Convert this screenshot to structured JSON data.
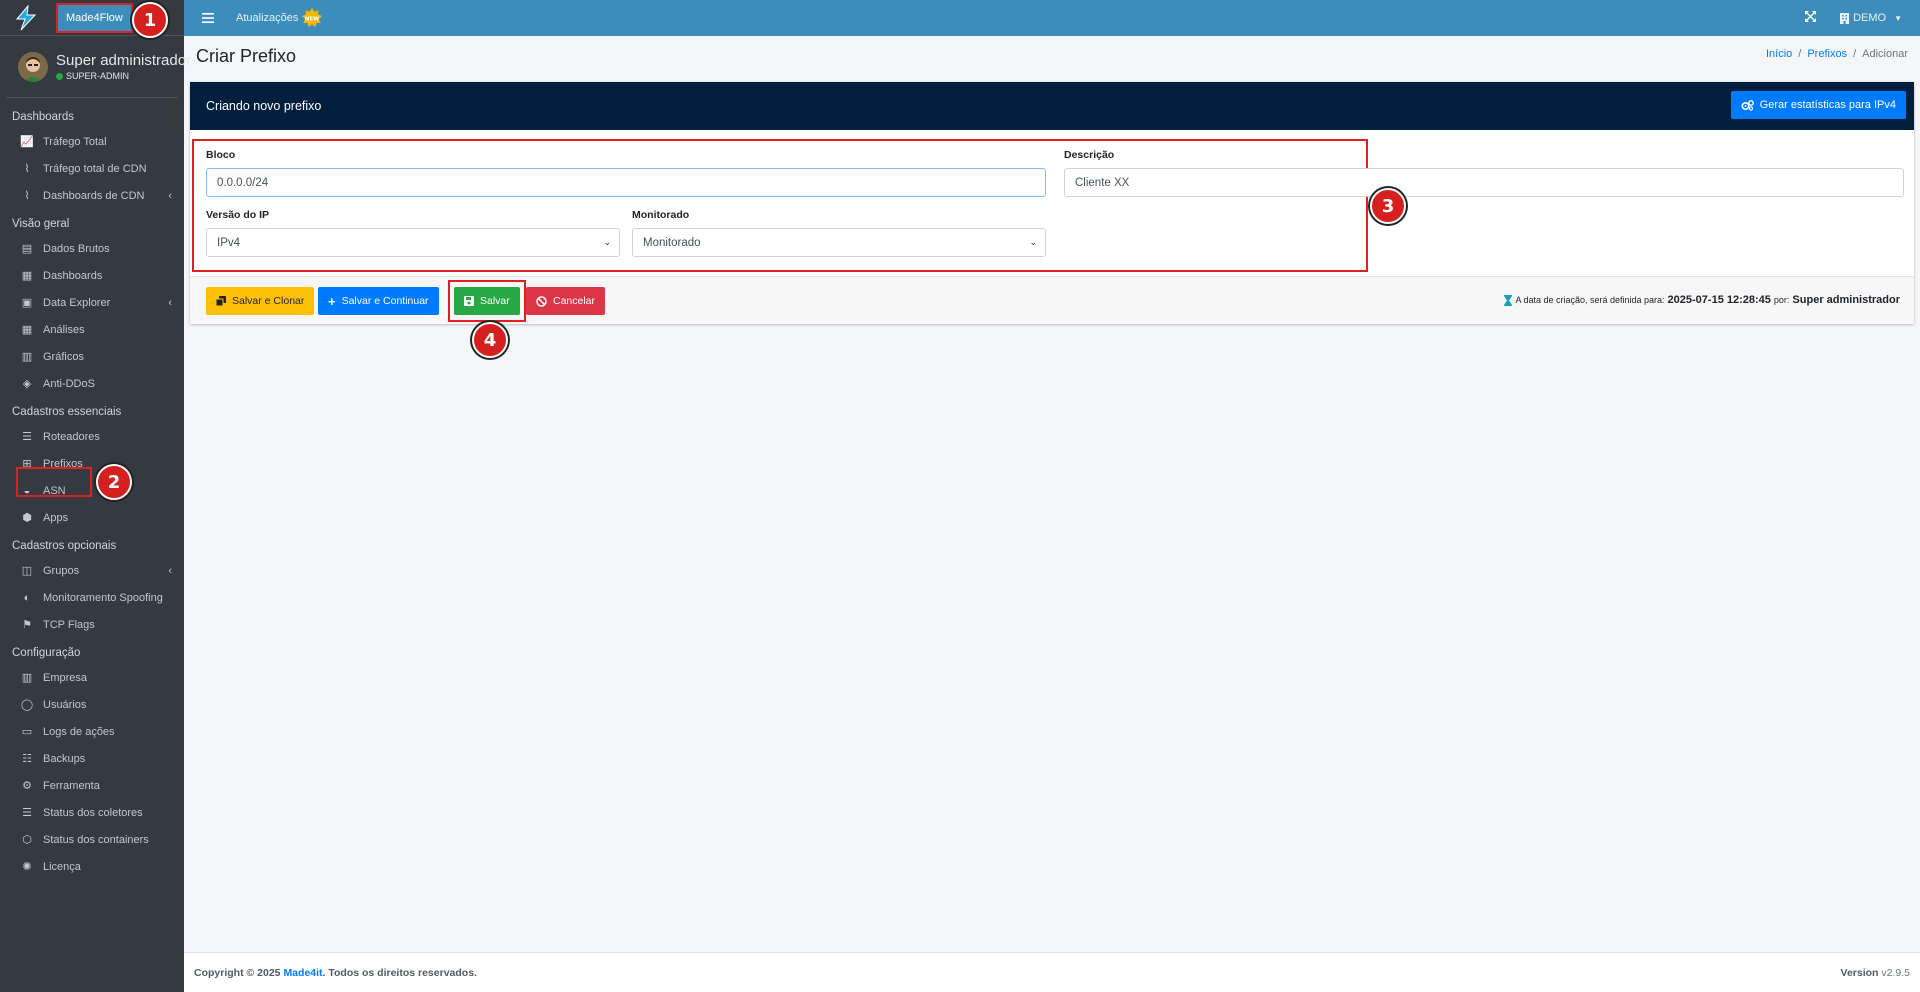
{
  "topbar": {
    "app_button": "Made4Flow",
    "updates_label": "Atualizações",
    "account_label": "DEMO"
  },
  "user": {
    "name": "Super administrador",
    "role": "SUPER-ADMIN"
  },
  "sidebar": {
    "sections": [
      {
        "header": "Dashboards",
        "items": [
          {
            "label": "Tráfego Total",
            "icon": "chart-line-icon"
          },
          {
            "label": "Tráfego total de CDN",
            "icon": "broadcast-tower-icon"
          },
          {
            "label": "Dashboards de CDN",
            "icon": "broadcast-tower-icon",
            "expandable": true
          }
        ]
      },
      {
        "header": "Visão geral",
        "items": [
          {
            "label": "Dados Brutos",
            "icon": "file-icon"
          },
          {
            "label": "Dashboards",
            "icon": "calendar-icon"
          },
          {
            "label": "Data Explorer",
            "icon": "file-alt-icon",
            "expandable": true
          },
          {
            "label": "Análises",
            "icon": "th-icon"
          },
          {
            "label": "Gráficos",
            "icon": "chart-bar-icon"
          },
          {
            "label": "Anti-DDoS",
            "icon": "shield-icon"
          }
        ]
      },
      {
        "header": "Cadastros essenciais",
        "items": [
          {
            "label": "Roteadores",
            "icon": "server-icon"
          },
          {
            "label": "Prefixos",
            "icon": "network-icon",
            "highlighted": true
          },
          {
            "label": "ASN",
            "icon": "satellite-dish-icon"
          },
          {
            "label": "Apps",
            "icon": "cube-icon"
          }
        ]
      },
      {
        "header": "Cadastros opcionais",
        "items": [
          {
            "label": "Grupos",
            "icon": "layer-group-icon",
            "expandable": true
          },
          {
            "label": "Monitoramento Spoofing",
            "icon": "user-secret-icon"
          },
          {
            "label": "TCP Flags",
            "icon": "flag-icon"
          }
        ]
      },
      {
        "header": "Configuração",
        "items": [
          {
            "label": "Empresa",
            "icon": "building-icon"
          },
          {
            "label": "Usuários",
            "icon": "user-icon"
          },
          {
            "label": "Logs de ações",
            "icon": "folder-open-icon"
          },
          {
            "label": "Backups",
            "icon": "database-icon"
          },
          {
            "label": "Ferramenta",
            "icon": "cog-icon"
          },
          {
            "label": "Status dos coletores",
            "icon": "list-icon"
          },
          {
            "label": "Status dos containers",
            "icon": "cubes-icon"
          },
          {
            "label": "Licença",
            "icon": "certificate-icon"
          }
        ]
      }
    ]
  },
  "page": {
    "title": "Criar Prefixo",
    "breadcrumb": [
      "Início",
      "Prefixos",
      "Adicionar"
    ]
  },
  "card": {
    "header_title": "Criando novo prefixo",
    "stats_button": "Gerar estatísticas para IPv4"
  },
  "form": {
    "bloco_label": "Bloco",
    "bloco_value": "0.0.0.0/24",
    "descricao_label": "Descrição",
    "descricao_value": "Cliente XX",
    "versao_label": "Versão do IP",
    "versao_value": "IPv4",
    "monitorado_label": "Monitorado",
    "monitorado_value": "Monitorado"
  },
  "actions": {
    "save_clone": "Salvar e Clonar",
    "save_continue": "Salvar e Continuar",
    "save": "Salvar",
    "cancel": "Cancelar"
  },
  "created": {
    "prefix": "A data de criação, será definida para:",
    "datetime": "2025-07-15 12:28:45",
    "by": "por:",
    "user": "Super administrador"
  },
  "footer": {
    "copyright": "Copyright © 2025",
    "company": "Made4it",
    "rights": ". Todos os direitos reservados.",
    "version_label": "Version",
    "version_value": "v2.9.5"
  },
  "markers": [
    "1",
    "2",
    "3",
    "4"
  ],
  "colors": {
    "topbar": "#3c8dbc",
    "sidebar": "#343a40",
    "card_header": "#001f3f",
    "highlight": "#e02020"
  }
}
